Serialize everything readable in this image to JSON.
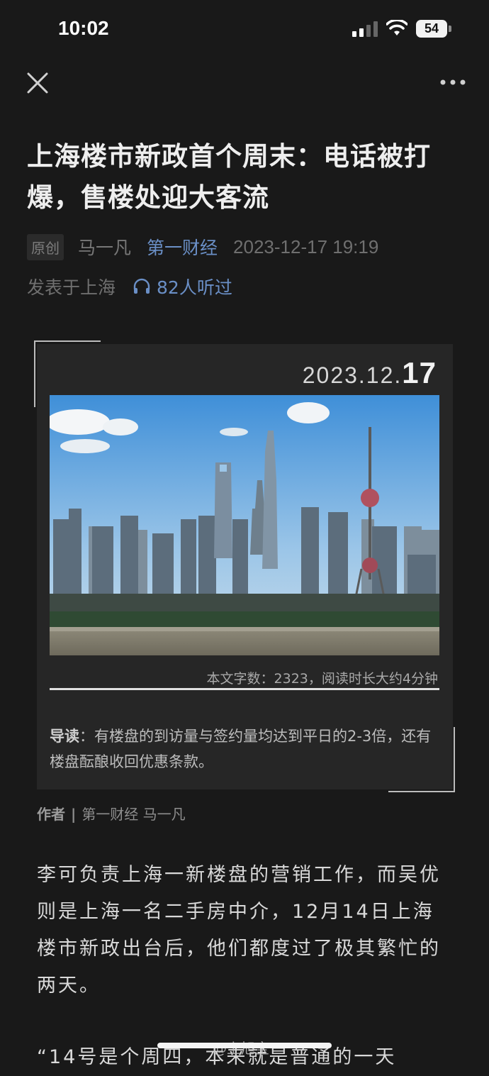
{
  "status_bar": {
    "time": "10:02",
    "battery": "54"
  },
  "article": {
    "title": "上海楼市新政首个周末：电话被打爆，售楼处迎大客流",
    "badge": "原创",
    "author": "马一凡",
    "source": "第一财经",
    "datetime": "2023-12-17 19:19",
    "location": "发表于上海",
    "listen_count": "82人听过"
  },
  "card": {
    "date_prefix": "2023.12.",
    "date_day": "17",
    "image_alt": "上海陆家嘴天际线",
    "word_count": "本文字数：2323，阅读时长大约4分钟",
    "intro_label": "导读",
    "intro_text": "：有楼盘的到访量与签约量均达到平日的2-3倍，还有楼盘酝酿收回优惠条款。"
  },
  "byline": {
    "label": "作者",
    "text": "第一财经 马一凡"
  },
  "body": {
    "paragraph1": "李可负责上海一新楼盘的营销工作，而吴优则是上海一名二手房中介，12月14日上海楼市新政出台后，他们都度过了极其繁忙的两天。",
    "paragraph2": "“14号是个周四，本来就是普通的一天"
  },
  "watermark": "@上旭宝"
}
